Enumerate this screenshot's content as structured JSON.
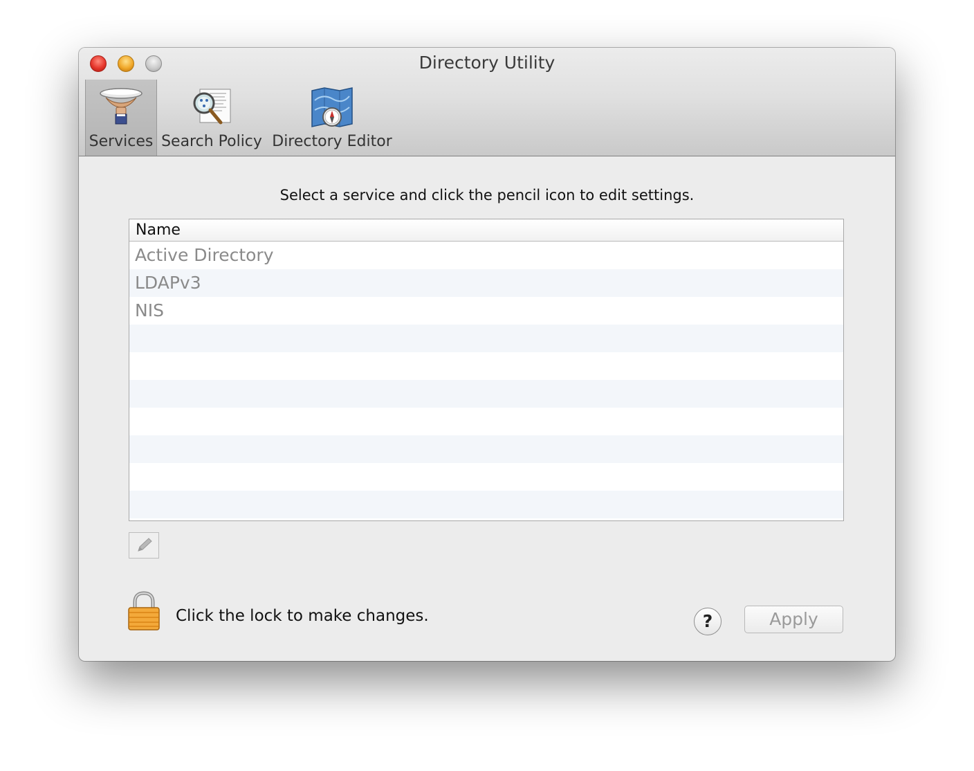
{
  "window": {
    "title": "Directory Utility"
  },
  "toolbar": {
    "items": [
      {
        "label": "Services",
        "icon": "services-icon",
        "selected": true
      },
      {
        "label": "Search Policy",
        "icon": "search-policy-icon",
        "selected": false
      },
      {
        "label": "Directory Editor",
        "icon": "directory-editor-icon",
        "selected": false
      }
    ]
  },
  "main": {
    "instruction": "Select a service and click the pencil icon to edit settings.",
    "table": {
      "column_header": "Name",
      "rows": [
        "Active Directory",
        "LDAPv3",
        "NIS"
      ]
    },
    "edit_button_icon": "pencil-icon"
  },
  "footer": {
    "lock_text": "Click the lock to make changes.",
    "lock_icon": "lock-icon",
    "help_label": "?",
    "apply_label": "Apply"
  },
  "colors": {
    "close": "#e6372c",
    "minimize": "#f0a82a",
    "zoom": "#c8c8c8",
    "row_alt": "#f3f6fa",
    "disabled_text": "#8a8a8a"
  }
}
